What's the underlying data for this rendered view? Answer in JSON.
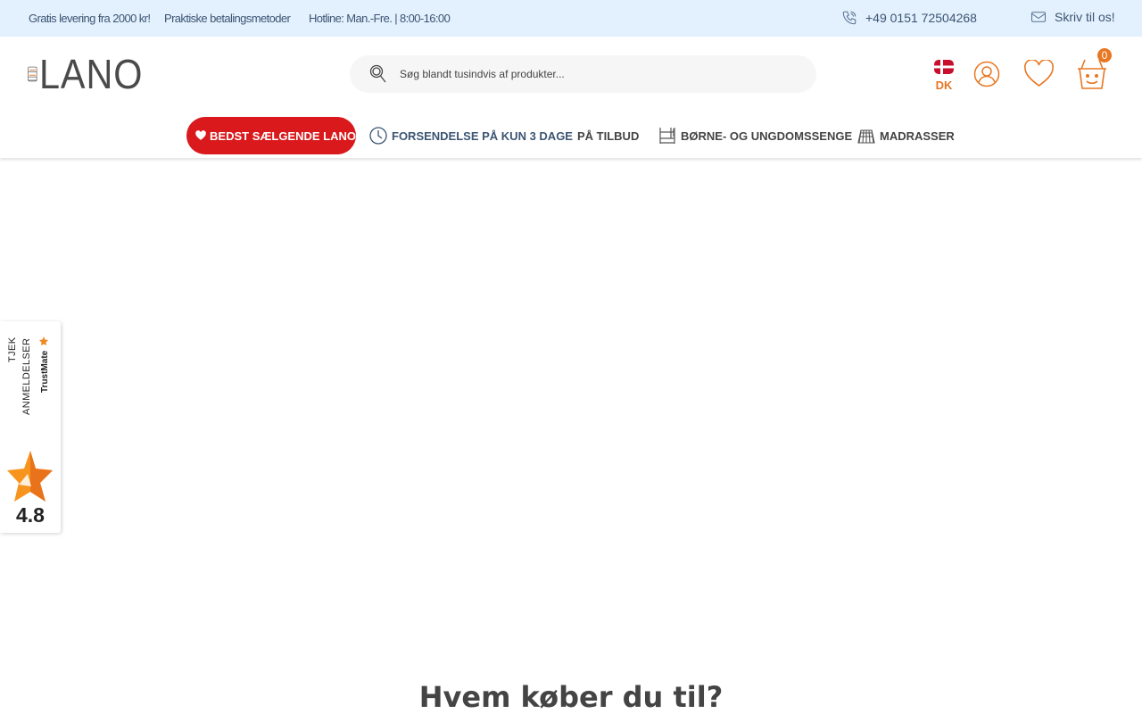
{
  "topbar": {
    "free_delivery": "Gratis levering fra 2000 kr!",
    "payment_methods": "Praktiske betalingsmetoder",
    "hotline": "Hotline: Man.-Fre. | 8:00-16:00",
    "phone": "+49 0151 72504268",
    "write_us": "Skriv til os!"
  },
  "header": {
    "logo_text": "LANO",
    "search_placeholder": "Søg blandt tusindvis af produkter...",
    "country_code": "DK",
    "cart_count": "0"
  },
  "nav": {
    "best_selling": "BEDST SÆLGENDE LANO",
    "shipping": "FORSENDELSE PÅ KUN 3 DAGE",
    "on_sale": "PÅ TILBUD",
    "kids_beds": "BØRNE- OG UNGDOMSSENGE",
    "mattresses": "MADRASSER"
  },
  "trustmate": {
    "check": "TJEK",
    "reviews": "ANMELDELSER",
    "brand": "TrustMate",
    "score": "4.8"
  },
  "main": {
    "heading": "Hvem køber du til?"
  },
  "colors": {
    "accent": "#e87722",
    "topbar_bg": "#e3f0fd",
    "topbar_text": "#3c5573",
    "best_selling_bg": "#d9191c"
  }
}
